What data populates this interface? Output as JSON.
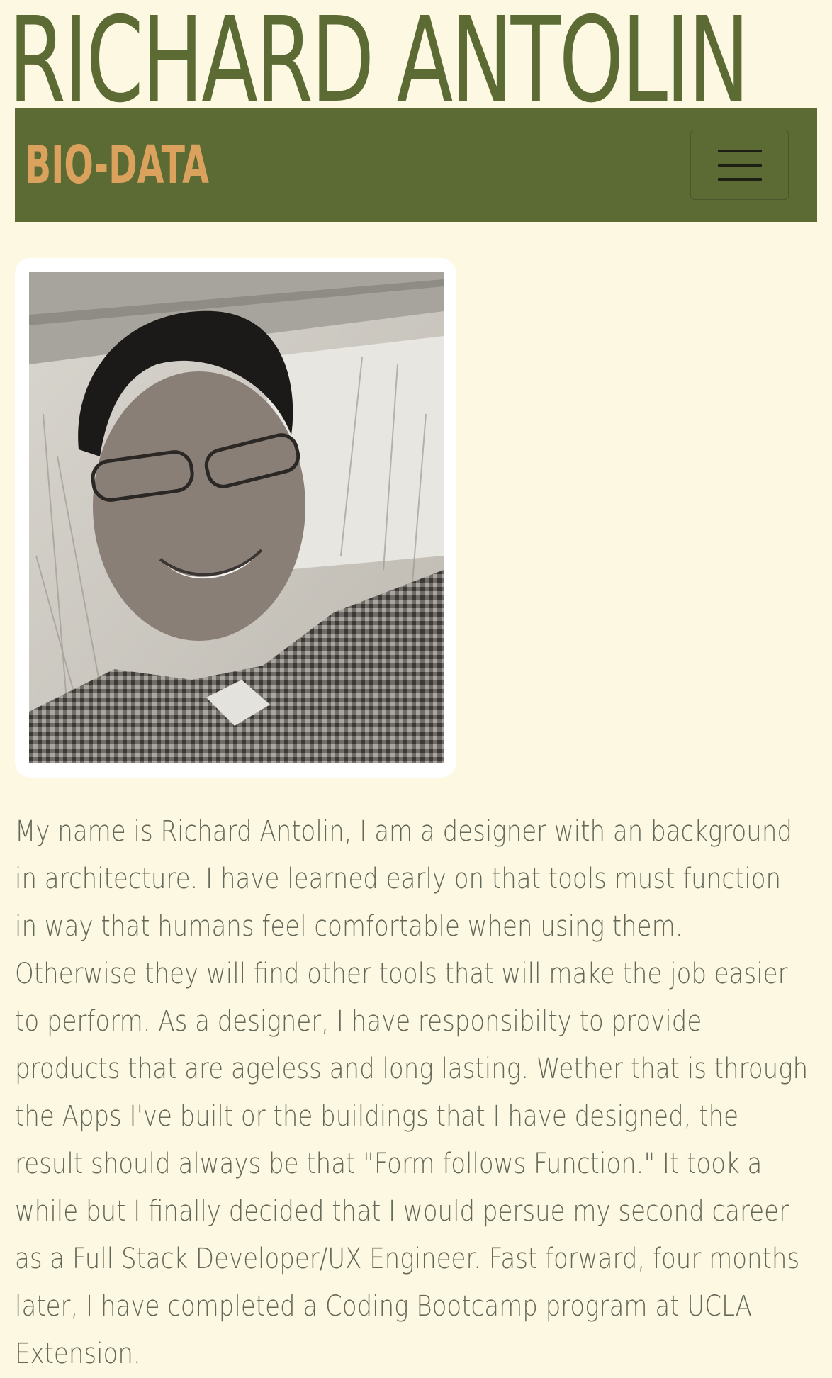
{
  "header": {
    "site_title": "RICHARD ANTOLIN"
  },
  "navbar": {
    "brand": "BIO-DATA",
    "toggle_icon": "hamburger-menu-icon"
  },
  "colors": {
    "background": "#fdf8e1",
    "accent_green": "#5c6b34",
    "brand_orange": "#dba25e",
    "body_text": "#646859"
  },
  "profile": {
    "photo_alt": "Richard Antolin"
  },
  "bio": {
    "text": "My name is Richard Antolin, I am a designer with an background in architecture. I have learned early on that tools must function in way that humans feel comfortable when using them. Otherwise they will find other tools that will make the job easier to perform. As a designer, I have responsibilty to provide products that are ageless and long lasting. Wether that is through the Apps I've built or the buildings that I have designed, the result should always be that \"Form follows Function.\" It took a while but I finally decided that I would persue my second career as a Full Stack Developer/UX Engineer. Fast forward, four months later, I have completed a Coding Bootcamp program at UCLA Extension."
  }
}
